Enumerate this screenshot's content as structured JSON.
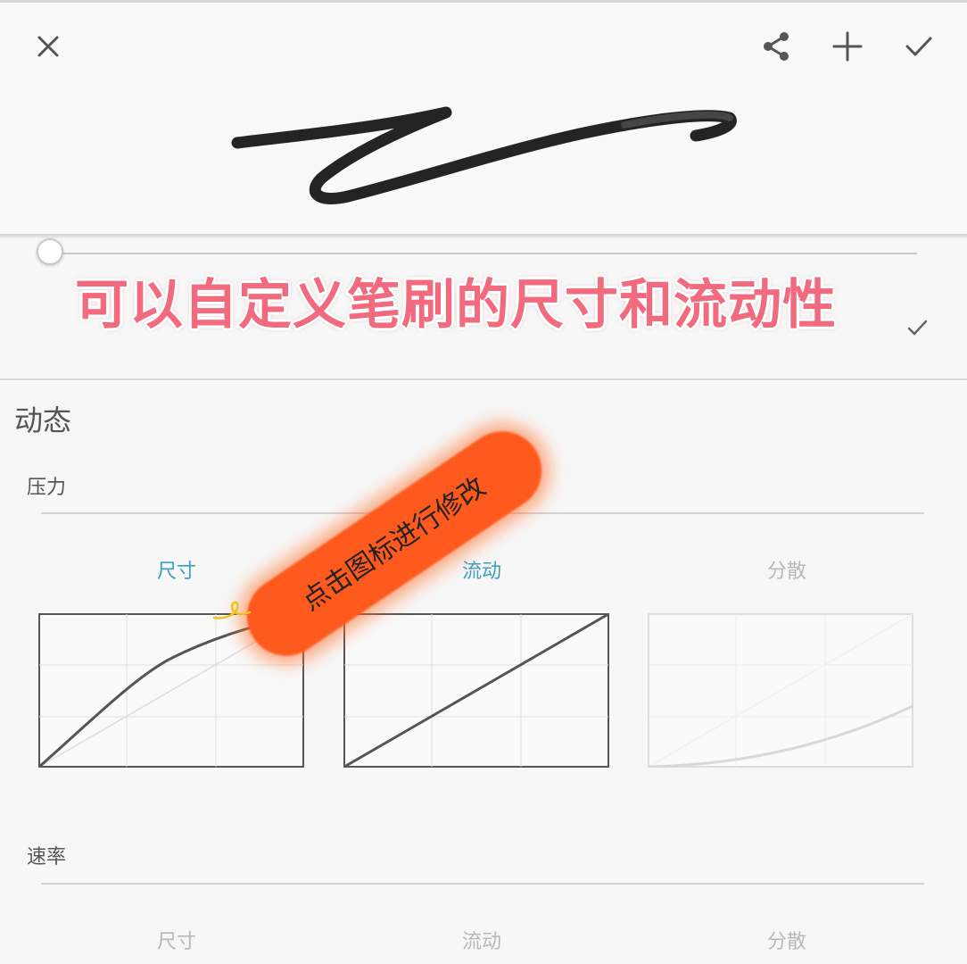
{
  "toolbar": {
    "close_icon": "close-icon",
    "share_icon": "share-icon",
    "add_icon": "plus-icon",
    "confirm_icon": "check-icon"
  },
  "annotation": {
    "banner": "可以自定义笔刷的尺寸和流动性",
    "hint": "点击图标进行修改"
  },
  "dynamics": {
    "title": "动态",
    "pressure": {
      "label": "压力",
      "curves": [
        {
          "label": "尺寸",
          "state": "active"
        },
        {
          "label": "流动",
          "state": "active"
        },
        {
          "label": "分散",
          "state": "inactive"
        }
      ]
    },
    "velocity": {
      "label": "速率",
      "curves": [
        {
          "label": "尺寸",
          "state": "inactive"
        },
        {
          "label": "流动",
          "state": "inactive"
        },
        {
          "label": "分散",
          "state": "inactive"
        }
      ]
    }
  },
  "colors": {
    "accent": "#3a9fc0",
    "banner_text": "#f26a7e",
    "highlight": "#ff5a1e"
  }
}
